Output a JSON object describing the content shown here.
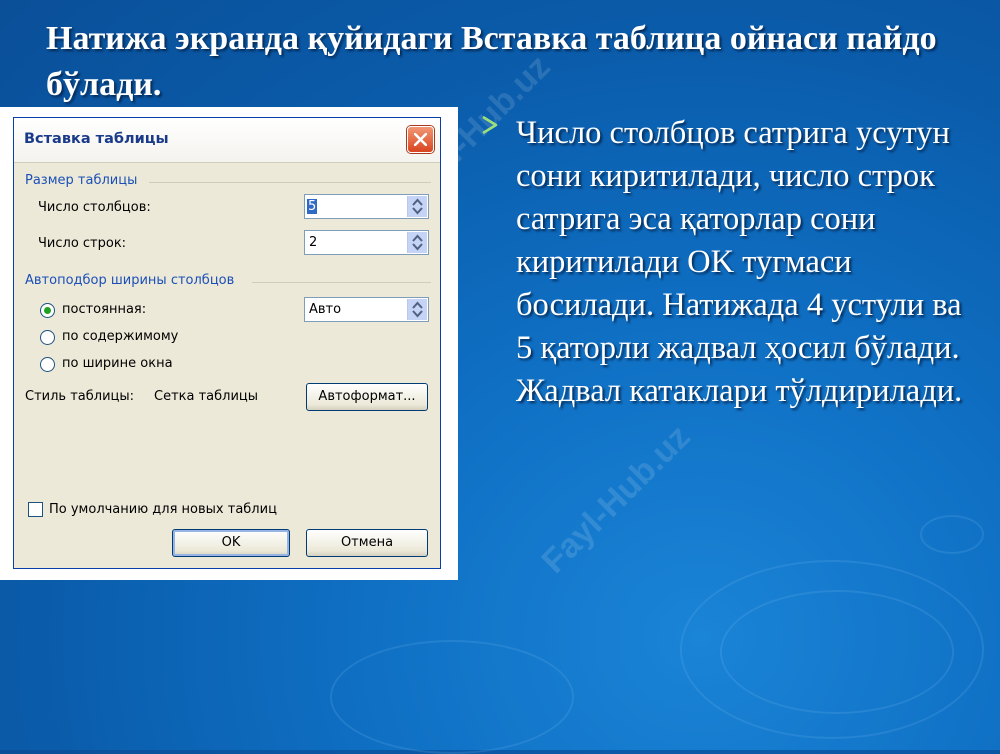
{
  "slide": {
    "title": "Натижа экранда қуйидаги Вставка таблица ойнаси пайдо бўлади.",
    "bullet_text": "Число столбцов сатрига усутун сони киритилади, число строк сатрига эса қаторлар сони киритилади OK тугмаси босилади. Натижада 4 устули ва 5 қаторли жадвал ҳосил бўлади. Жадвал катаклари тўлдирилади.",
    "bullet_icon": "arrow-bullet-icon"
  },
  "dialog": {
    "title": "Вставка таблицы",
    "size_group": "Размер таблицы",
    "columns_label": "Число столбцов:",
    "columns_value": "5",
    "rows_label": "Число строк:",
    "rows_value": "2",
    "autofit_group": "Автоподбор ширины столбцов",
    "option_fixed": "постоянная:",
    "fixed_value": "Авто",
    "option_content": "по содержимому",
    "option_window": "по ширине окна",
    "style_label": "Стиль таблицы:",
    "style_value": "Сетка таблицы",
    "autoformat_button": "Автоформат...",
    "default_checkbox": "По умолчанию для новых таблиц",
    "ok_button": "OK",
    "cancel_button": "Отмена"
  },
  "watermark": "Fayl-Hub.uz",
  "colors": {
    "background": "#0f6fc3",
    "title_text": "#ffffff",
    "dialog_face": "#ece9d8",
    "close_button": "#d8451f"
  }
}
